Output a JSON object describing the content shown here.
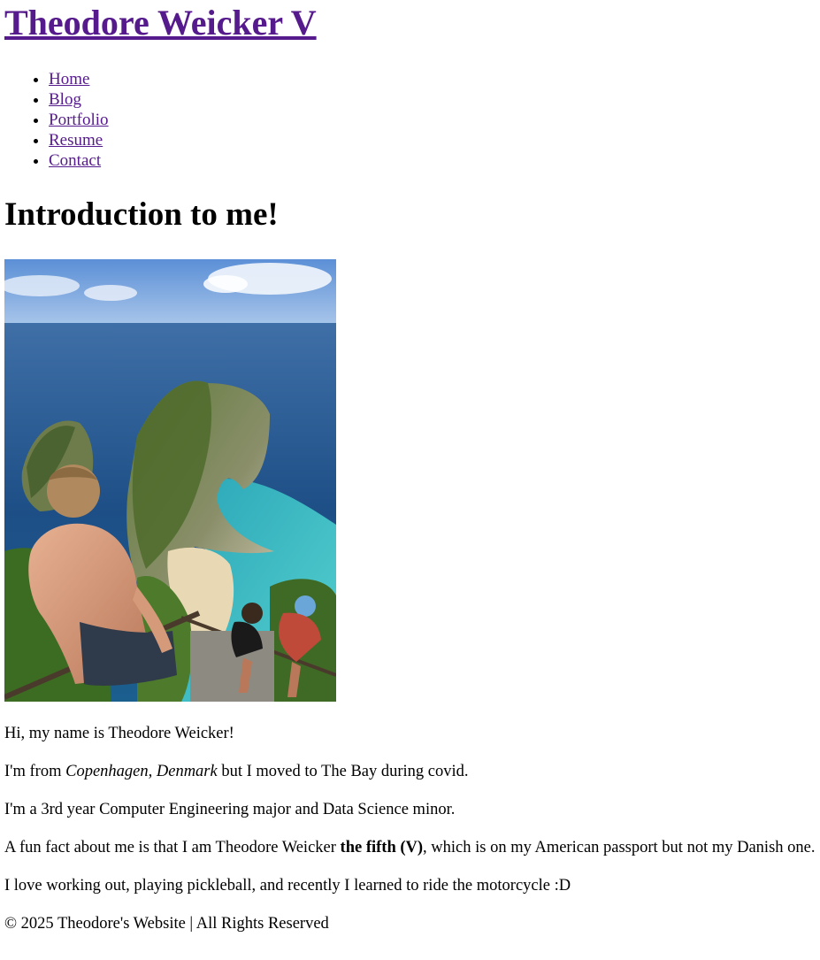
{
  "site": {
    "title": "Theodore Weicker V"
  },
  "nav": {
    "items": [
      {
        "label": "Home"
      },
      {
        "label": "Blog"
      },
      {
        "label": "Portfolio"
      },
      {
        "label": "Resume"
      },
      {
        "label": "Contact"
      }
    ]
  },
  "main": {
    "heading": "Introduction to me!",
    "photo_alt": "Theodore at Kelingking Beach cliff overlooking the ocean",
    "p1": "Hi, my name is Theodore Weicker!",
    "p2": {
      "before": "I'm from ",
      "italic": "Copenhagen, Denmark",
      "after": " but I moved to The Bay during covid."
    },
    "p3": "I'm a 3rd year Computer Engineering major and Data Science minor.",
    "p4": {
      "before": "A fun fact about me is that I am Theodore Weicker ",
      "bold": "the fifth (V)",
      "after": ", which is on my American passport but not my Danish one."
    },
    "p5": "I love working out, playing pickleball, and recently I learned to ride the motorcycle :D"
  },
  "footer": {
    "text": "© 2025 Theodore's Website | All Rights Reserved"
  },
  "colors": {
    "link": "#551a8b",
    "text": "#000000",
    "background": "#ffffff"
  }
}
